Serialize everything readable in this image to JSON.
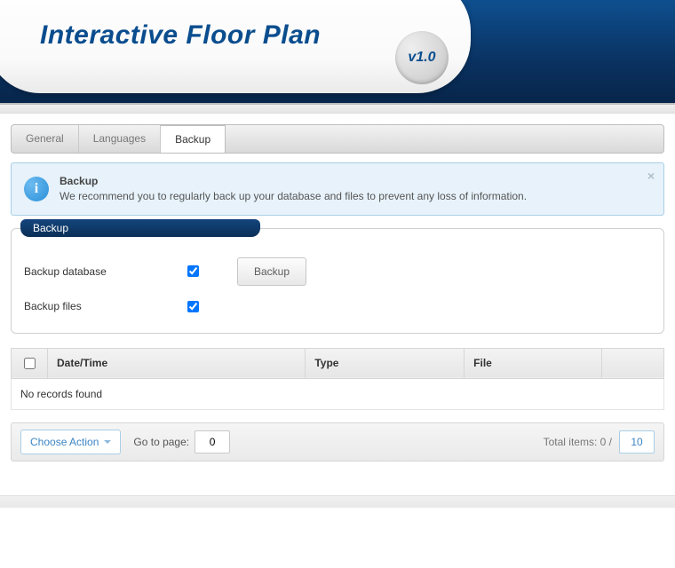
{
  "header": {
    "title": "Interactive Floor Plan",
    "version": "v1.0"
  },
  "tabs": [
    {
      "label": "General",
      "active": false
    },
    {
      "label": "Languages",
      "active": false
    },
    {
      "label": "Backup",
      "active": true
    }
  ],
  "info": {
    "title": "Backup",
    "message": "We recommend you to regularly back up your database and files to prevent any loss of information."
  },
  "fieldset": {
    "legend": "Backup",
    "rows": {
      "database_label": "Backup database",
      "files_label": "Backup files",
      "button_label": "Backup"
    }
  },
  "table": {
    "columns": {
      "datetime": "Date/Time",
      "type": "Type",
      "file": "File"
    },
    "empty_message": "No records found"
  },
  "footer": {
    "choose_action": "Choose Action",
    "go_to_page_label": "Go to page:",
    "page_value": "0",
    "total_label": "Total items: 0 /",
    "per_page_value": "10"
  }
}
